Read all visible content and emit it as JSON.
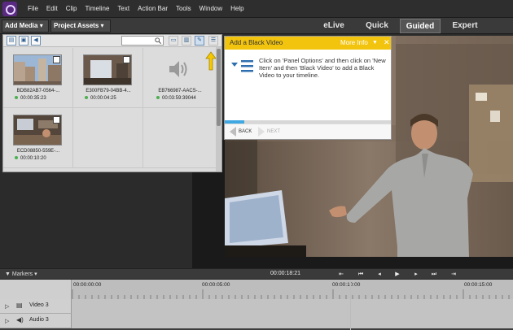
{
  "menu": [
    "File",
    "Edit",
    "Clip",
    "Timeline",
    "Text",
    "Action Bar",
    "Tools",
    "Window",
    "Help"
  ],
  "modebar": {
    "add_media": "Add Media",
    "project_assets": "Project Assets",
    "tabs": [
      "eLive",
      "Quick",
      "Guided",
      "Expert"
    ],
    "active_tab": "Guided"
  },
  "assets": [
    {
      "name": "BDB82AB7-0564-...",
      "duration": "00:00:35:23",
      "kind": "video"
    },
    {
      "name": "E300FB79-04BB-4...",
      "duration": "00:00:04:25",
      "kind": "video"
    },
    {
      "name": "EB766987-AACS-...",
      "duration": "00:03:59:39044",
      "kind": "audio"
    },
    {
      "name": "ECD08850-559E-...",
      "duration": "00:00:10:20",
      "kind": "video"
    }
  ],
  "guide": {
    "title": "Add a Black Video",
    "more_info": "More Info",
    "close": "✕",
    "instructions": "Click on 'Panel Options' and then click on 'New Item' and then 'Black Video' to add a Black Video to your timeline.",
    "back": "BACK",
    "next": "NEXT",
    "progress": 0.12
  },
  "transport": {
    "markers": "Markers",
    "timecode": "00:00:18:21"
  },
  "timeline": {
    "ruler_labels": [
      "00:00:00:00",
      "00:00:05:00",
      "00:00:10:00",
      "00:00:15:00"
    ],
    "tracks": [
      {
        "label": "Video 3",
        "icon": "film-icon"
      },
      {
        "label": "Audio 3",
        "icon": "speaker-icon"
      }
    ]
  }
}
